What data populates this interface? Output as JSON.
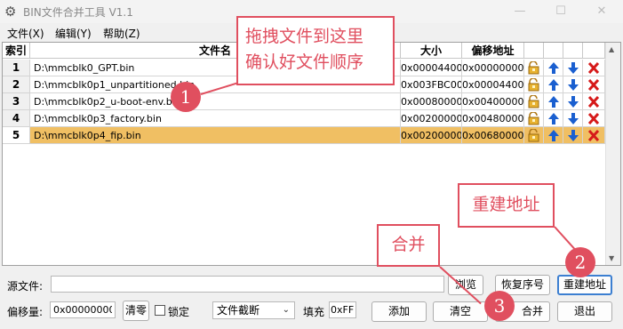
{
  "window": {
    "title": "BIN文件合并工具 V1.1"
  },
  "menu": [
    {
      "label": "文件(X)"
    },
    {
      "label": "编辑(Y)"
    },
    {
      "label": "帮助(Z)"
    }
  ],
  "table": {
    "headers": {
      "index": "索引",
      "filename": "文件名",
      "size": "大小",
      "offset": "偏移地址"
    },
    "rows": [
      {
        "index": "1",
        "file": "D:\\mmcblk0_GPT.bin",
        "size": "0x00004400",
        "offset": "0x00000000"
      },
      {
        "index": "2",
        "file": "D:\\mmcblk0p1_unpartitioned.bin",
        "size": "0x003FBC00",
        "offset": "0x00004400"
      },
      {
        "index": "3",
        "file": "D:\\mmcblk0p2_u-boot-env.bin",
        "size": "0x00080000",
        "offset": "0x00400000"
      },
      {
        "index": "4",
        "file": "D:\\mmcblk0p3_factory.bin",
        "size": "0x00200000",
        "offset": "0x00480000"
      },
      {
        "index": "5",
        "file": "D:\\mmcblk0p4_fip.bin",
        "size": "0x00200000",
        "offset": "0x00680000"
      }
    ],
    "selected_row": "5"
  },
  "controls": {
    "source_label": "源文件:",
    "source_value": "",
    "browse": "浏览",
    "restore_index": "恢复序号",
    "rebuild_address": "重建地址",
    "offset_label": "偏移量:",
    "offset_value": "0x00000000",
    "clear_zero": "清零",
    "lock": "锁定",
    "mode_value": "文件截断",
    "fill_label": "填充",
    "fill_value": "0xFF",
    "add": "添加",
    "clear": "清空",
    "merge": "合并",
    "exit": "退出"
  },
  "annotations": {
    "drag_note_line1": "拖拽文件到这里",
    "drag_note_line2": "确认好文件顺序",
    "rebuild_note": "重建地址",
    "merge_note": "合并",
    "badge1": "1",
    "badge2": "2",
    "badge3": "3"
  },
  "colors": {
    "selected_row": "#f0bf63",
    "annotation": "#e04f5f",
    "primary_border": "#3c7fd1"
  }
}
